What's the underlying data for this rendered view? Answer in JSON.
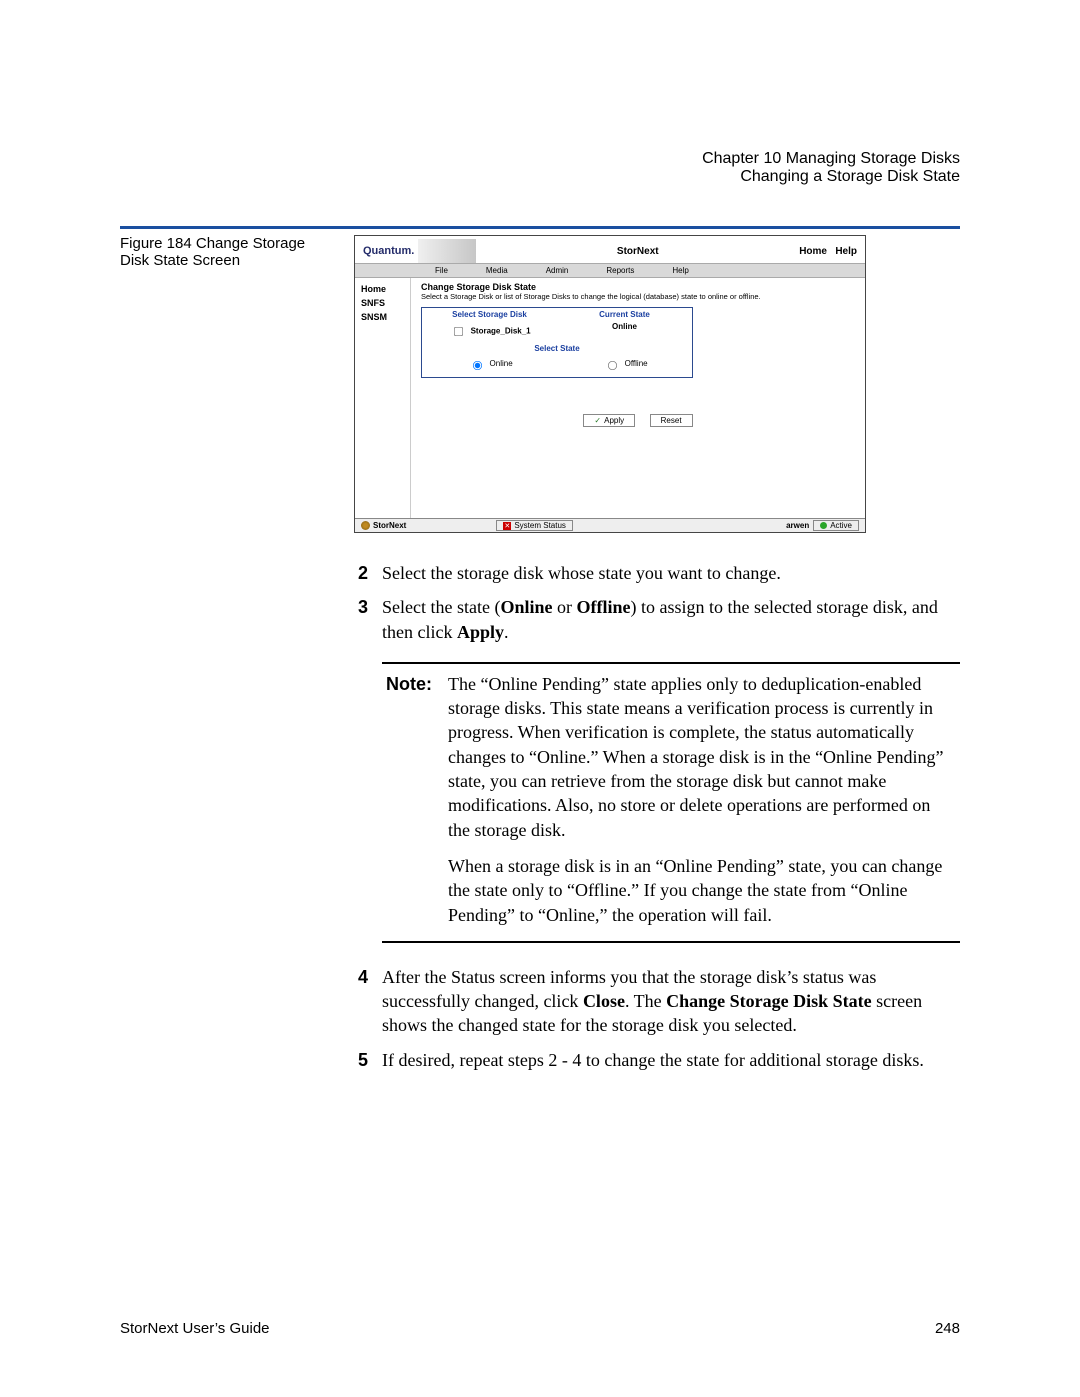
{
  "header": {
    "chapter_line": "Chapter 10  Managing Storage Disks",
    "section_line": "Changing a Storage Disk State"
  },
  "figure_caption": "Figure 184  Change Storage Disk State Screen",
  "screenshot": {
    "logo": "Quantum.",
    "title": "StorNext",
    "home": "Home",
    "help": "Help",
    "menu": {
      "file": "File",
      "media": "Media",
      "admin": "Admin",
      "reports": "Reports",
      "help": "Help"
    },
    "sidebar": {
      "home": "Home",
      "snfs": "SNFS",
      "snsm": "SNSM"
    },
    "panel_title": "Change Storage Disk State",
    "panel_sub": "Select a Storage Disk or list of Storage Disks to change the logical (database) state to online or offline.",
    "hdr_select": "Select Storage Disk",
    "hdr_current": "Current State",
    "disk_name": "Storage_Disk_1",
    "disk_state": "Online",
    "section_state": "Select State",
    "radio_online": "Online",
    "radio_offline": "Offline",
    "btn_apply": "Apply",
    "btn_reset": "Reset",
    "status_brand": "StorNext",
    "system_status": "System Status",
    "host": "arwen",
    "active": "Active"
  },
  "steps": {
    "s2": "Select the storage disk whose state you want to change.",
    "s3_a": "Select the state (",
    "s3_b": "Online",
    "s3_c": " or ",
    "s3_d": "Offline",
    "s3_e": ") to assign to the selected storage disk, and then click ",
    "s3_f": "Apply",
    "s3_g": ".",
    "note_label": "Note:",
    "note_p1": "The “Online Pending” state applies only to deduplication-enabled storage disks. This state means a verification process is currently in progress. When verification is complete, the status automatically changes to “Online.” When a storage disk is in the “Online Pending” state, you can retrieve from the storage disk but cannot make modifications. Also, no store or delete operations are performed on the storage disk.",
    "note_p2": "When a storage disk is in an “Online Pending” state, you can change the state only to “Offline.” If you change the state from “Online Pending” to “Online,” the operation will fail.",
    "s4_a": "After the Status screen informs you that the storage disk’s status was successfully changed, click ",
    "s4_b": "Close",
    "s4_c": ". The ",
    "s4_d": "Change Storage Disk State",
    "s4_e": " screen shows the changed state for the storage disk you selected.",
    "s5": "If desired, repeat steps 2 - 4 to change the state for additional storage disks."
  },
  "footer": {
    "left": "StorNext User’s Guide",
    "right": "248"
  }
}
